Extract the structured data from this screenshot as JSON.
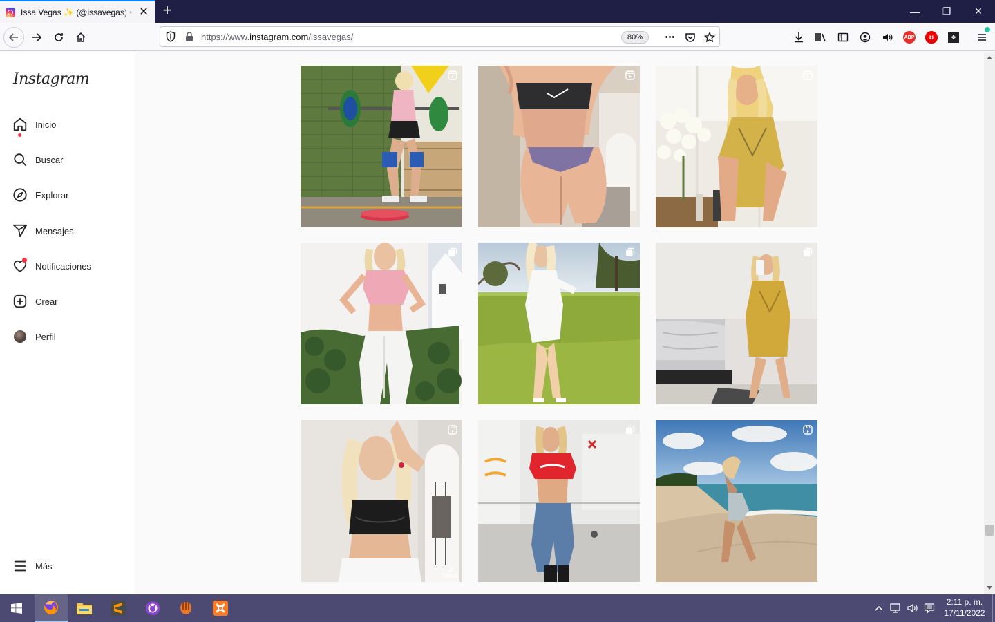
{
  "browser": {
    "tab_title": "Issa Vegas ✨ (@issavegas) • Fotos y videos de Instagram",
    "tab_close": "✕",
    "new_tab": "+",
    "url_scheme": "https://www.",
    "url_host": "instagram.com",
    "url_path": "/issavegas/",
    "zoom": "80%",
    "page_actions": "•••",
    "window_controls": {
      "minimize": "—",
      "restore": "❐",
      "close": "✕"
    }
  },
  "sidebar": {
    "logo": "Instagram",
    "items": [
      {
        "label": "Inicio",
        "icon": "home-icon"
      },
      {
        "label": "Buscar",
        "icon": "search-icon"
      },
      {
        "label": "Explorar",
        "icon": "compass-icon"
      },
      {
        "label": "Mensajes",
        "icon": "messenger-icon"
      },
      {
        "label": "Notificaciones",
        "icon": "heart-icon"
      },
      {
        "label": "Crear",
        "icon": "create-icon"
      },
      {
        "label": "Perfil",
        "icon": "avatar"
      }
    ],
    "more": {
      "label": "Más",
      "icon": "menu-icon"
    }
  },
  "posts": [
    {
      "type": "reel",
      "subject": "weightlifting in gym"
    },
    {
      "type": "reel",
      "subject": "black sports bra, rear view"
    },
    {
      "type": "reel",
      "subject": "gold dress with orchids"
    },
    {
      "type": "carousel",
      "subject": "pink top and white joggers"
    },
    {
      "type": "carousel",
      "subject": "white dress on grass field"
    },
    {
      "type": "carousel",
      "subject": "gold dress mirror selfie"
    },
    {
      "type": "reel",
      "subject": "black crop top, tiktok",
      "watermark": "TikTok"
    },
    {
      "type": "carousel",
      "subject": "red Amore top and jeans"
    },
    {
      "type": "reel",
      "subject": "swimsuit on the beach"
    }
  ],
  "taskbar": {
    "clock_time": "2:11 p. m.",
    "clock_date": "17/11/2022",
    "apps": [
      "windows-start",
      "firefox",
      "file-explorer",
      "sublime-text",
      "github-desktop",
      "baseball-glove-app",
      "xampp"
    ]
  },
  "colors": {
    "tabbar": "#1f1f46",
    "taskbar": "#4c4a73",
    "notification_dot": "#ff3040"
  }
}
